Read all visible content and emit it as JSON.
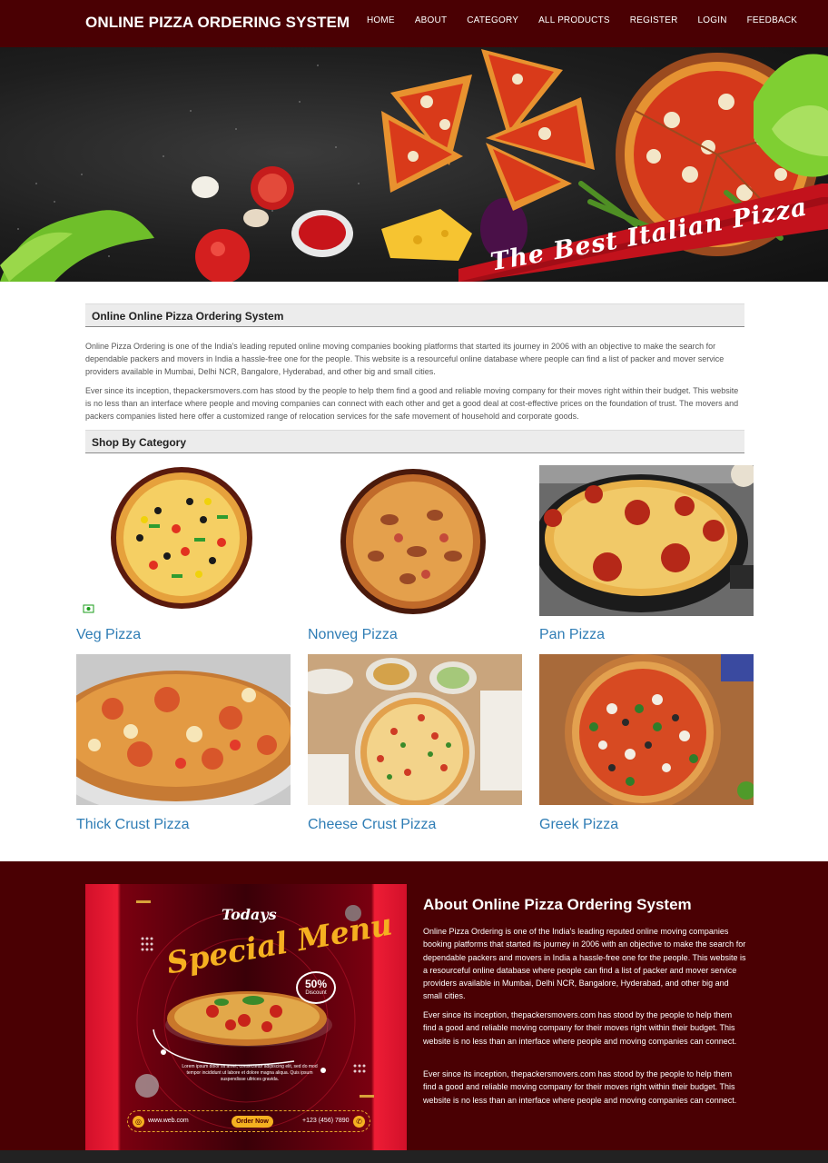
{
  "brand": "ONLINE PIZZA ORDERING SYSTEM",
  "nav": [
    "HOME",
    "ABOUT",
    "CATEGORY",
    "ALL PRODUCTS",
    "REGISTER",
    "LOGIN",
    "FEEDBACK"
  ],
  "hero": {
    "banner_text": "The Best Italian Pizza"
  },
  "intro": {
    "heading": "Online Online Pizza Ordering System",
    "p1": "Online Pizza Ordering is one of the India's leading reputed online moving companies booking platforms that started its journey in 2006 with an objective to make the search for dependable packers and movers in India a hassle-free one for the people. This website is a resourceful online database where people can find a list of packer and mover service providers available in Mumbai, Delhi NCR, Bangalore, Hyderabad, and other big and small cities.",
    "p2": "Ever since its inception, thepackersmovers.com has stood by the people to help them find a good and reliable moving company for their moves right within their budget. This website is no less than an interface where people and moving companies can connect with each other and get a good deal at cost-effective prices on the foundation of trust. The movers and packers companies listed here offer a customized range of relocation services for the safe movement of household and corporate goods."
  },
  "categories": {
    "heading": "Shop By Category",
    "items": [
      {
        "name": "Veg Pizza"
      },
      {
        "name": "Nonveg Pizza"
      },
      {
        "name": "Pan Pizza"
      },
      {
        "name": "Thick Crust Pizza"
      },
      {
        "name": "Cheese Crust Pizza"
      },
      {
        "name": "Greek Pizza"
      }
    ]
  },
  "about": {
    "title": "About Online Pizza Ordering System",
    "p1": "Online Pizza Ordering is one of the India's leading reputed online moving companies booking platforms that started its journey in 2006 with an objective to make the search for dependable packers and movers in India a hassle-free one for the people. This website is a resourceful online database where people can find a list of packer and mover service providers available in Mumbai, Delhi NCR, Bangalore, Hyderabad, and other big and small cities.",
    "p2": "Ever since its inception, thepackersmovers.com has stood by the people to help them find a good and reliable moving company for their moves right within their budget. This website is no less than an interface where people and moving companies can connect.",
    "p3": "Ever since its inception, thepackersmovers.com has stood by the people to help them find a good and reliable moving company for their moves right within their budget. This website is no less than an interface where people and moving companies can connect."
  },
  "promo": {
    "todays": "Todays",
    "title": "Special Menu",
    "discount_value": "50%",
    "discount_label": "Discount",
    "lorem": "Lorem ipsum dolor sit amet, consectetur adipiscing elit, sed do mod tempor incididunt ut labore et dolore magna aliqua. Quis ipsum suspendisse ultrices gravida.",
    "website": "www.web.com",
    "order_button": "Order Now",
    "phone": "+123 (456) 7890"
  },
  "colors": {
    "brand_dark": "#4a0003",
    "link_blue": "#2f7db5",
    "accent_gold": "#f5b020"
  }
}
